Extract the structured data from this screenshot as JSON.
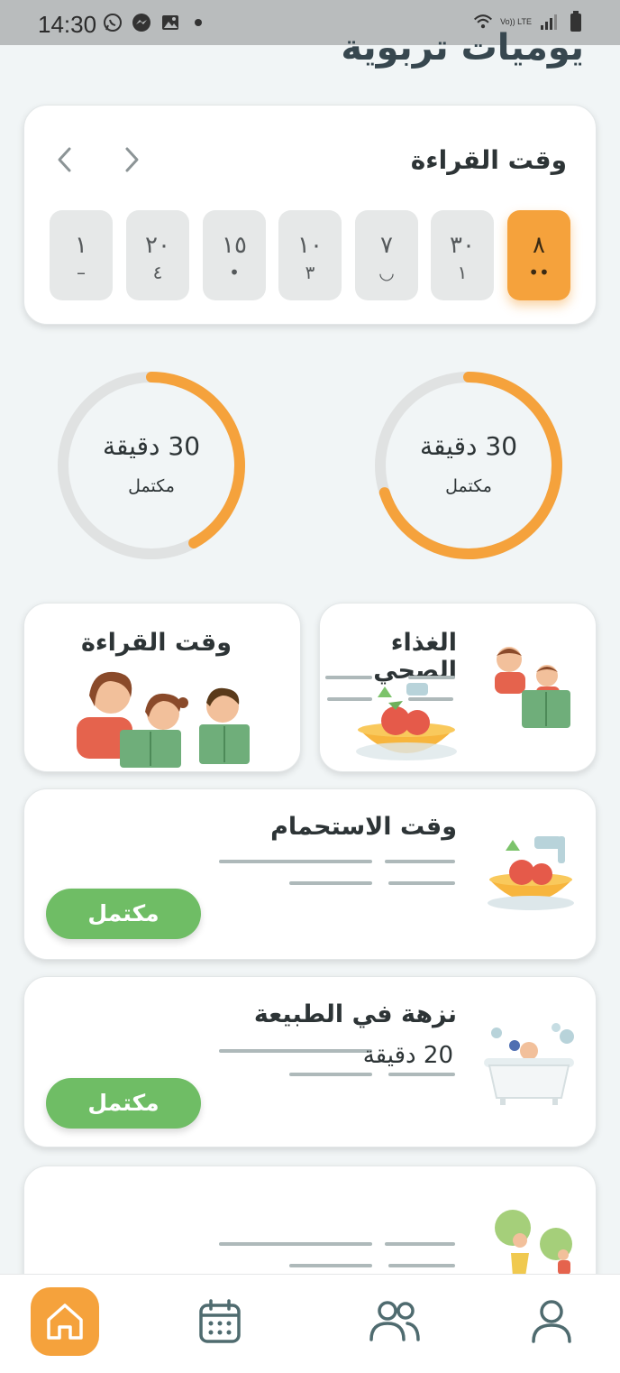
{
  "status_bar": {
    "time": "14:30",
    "volte": "Vo)) LTE"
  },
  "page": {
    "title": "يوميات تربوية"
  },
  "reading_card": {
    "title": "وقت القراءة",
    "days": [
      {
        "top": "٨",
        "bottom": "••",
        "active": true
      },
      {
        "top": "٣٠",
        "bottom": "١",
        "active": false
      },
      {
        "top": "٧",
        "bottom": "◡",
        "active": false
      },
      {
        "top": "١٠",
        "bottom": "٣",
        "active": false
      },
      {
        "top": "١٥",
        "bottom": "•",
        "active": false
      },
      {
        "top": "٢٠",
        "bottom": "٤",
        "active": false
      },
      {
        "top": "١",
        "bottom": "–",
        "active": false
      }
    ]
  },
  "rings": [
    {
      "value": "30 دقيقة",
      "label": "مكتمل",
      "progress": 0.7
    },
    {
      "value": "30 دقيقة",
      "label": "مكتمل",
      "progress": 0.42
    }
  ],
  "small_cards": [
    {
      "title": "الغذاء الصحي"
    },
    {
      "title": "وقت القراءة"
    }
  ],
  "activities": [
    {
      "title": "وقت الاستحمام",
      "subtitle": "",
      "button": "مكتمل"
    },
    {
      "title": "نزهة في الطبيعة",
      "subtitle": "20 دقيقة",
      "button": "مكتمل"
    },
    {
      "title": "",
      "subtitle": "",
      "button": ""
    }
  ],
  "nav": {
    "items": [
      "home-icon",
      "calendar-icon",
      "users-icon",
      "profile-icon"
    ]
  },
  "colors": {
    "accent": "#f5a23c",
    "success": "#6fbd65",
    "ring_track": "#e0e2e2"
  }
}
